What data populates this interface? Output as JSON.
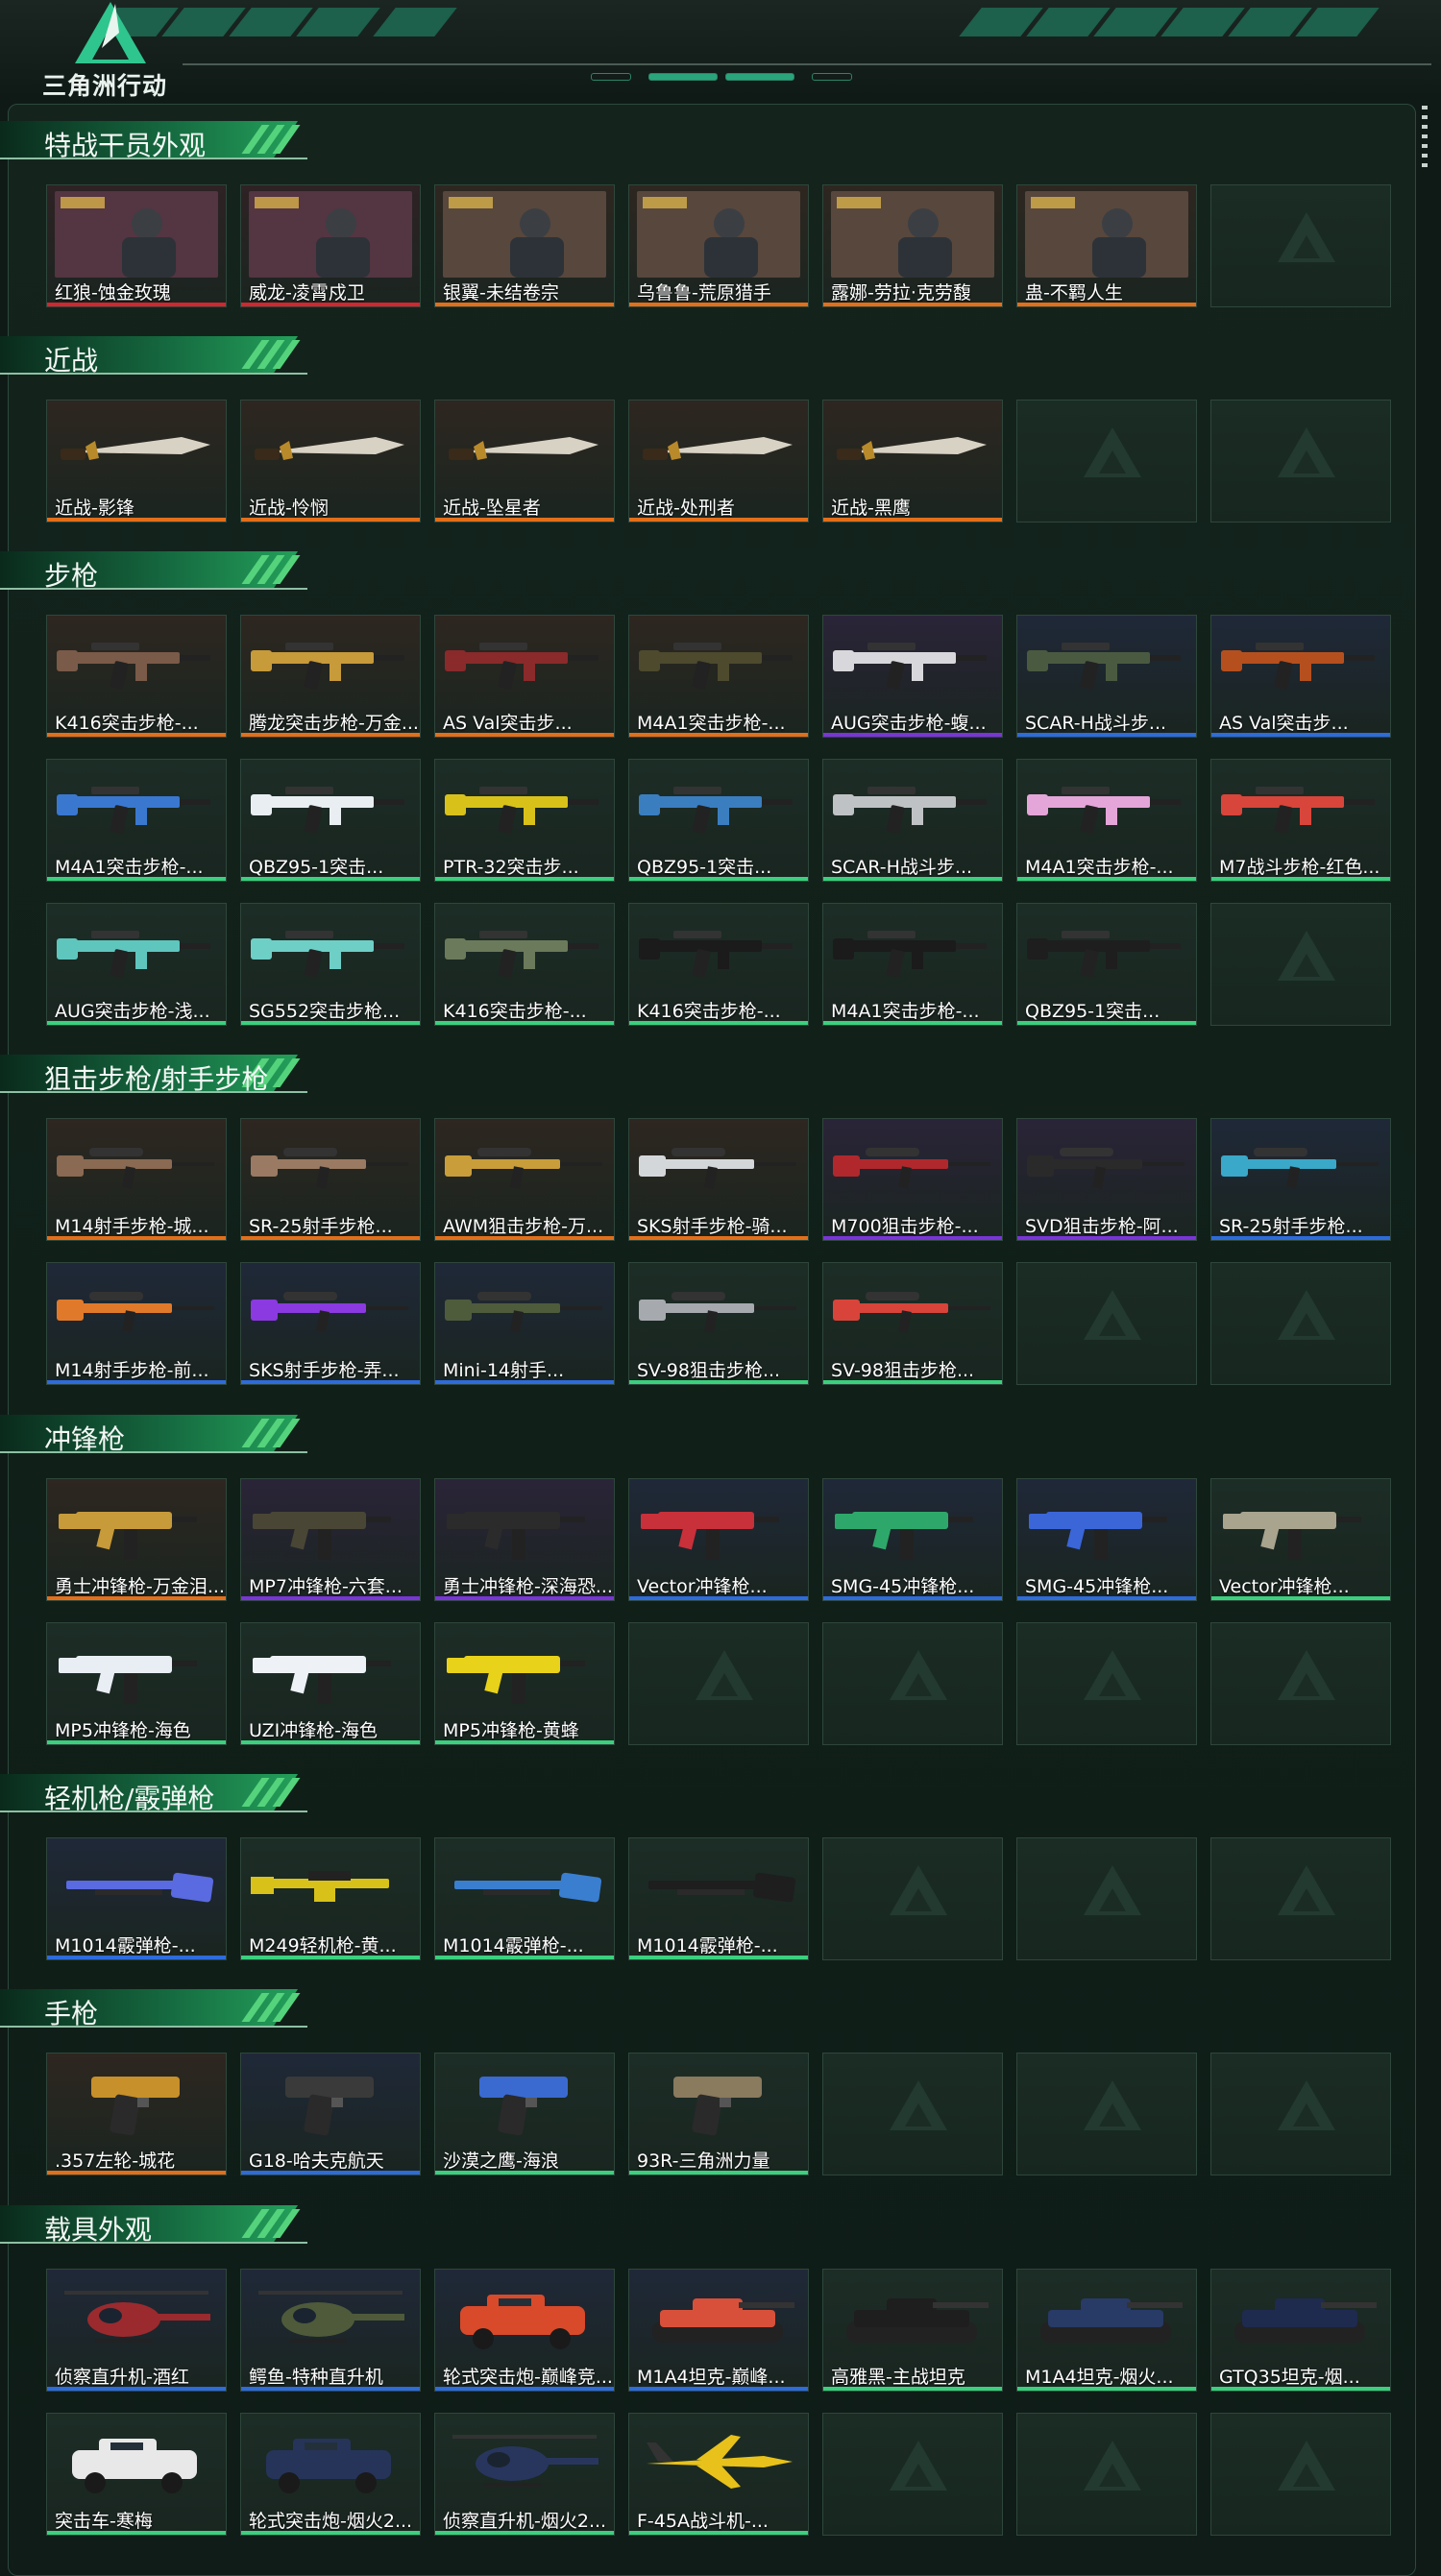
{
  "app": {
    "logo_text": "三角洲行动"
  },
  "colors": {
    "orange": "#e36f1a",
    "red": "#d3262e",
    "purple": "#7a35d8",
    "blue": "#2e6bdb",
    "green": "#3bd07e",
    "gray": "#c9ccca"
  },
  "sections": [
    {
      "title": "特战干员外观",
      "rows": [
        [
          {
            "label": "红狼-蚀金玫瑰",
            "rarity": "red",
            "icon": "operator-portrait"
          },
          {
            "label": "威龙-凌霄戍卫",
            "rarity": "red",
            "icon": "operator-portrait"
          },
          {
            "label": "银翼-未结卷宗",
            "rarity": "orange",
            "icon": "operator-portrait"
          },
          {
            "label": "乌鲁鲁-荒原猎手",
            "rarity": "orange",
            "icon": "operator-portrait"
          },
          {
            "label": "露娜-劳拉·克劳馥",
            "rarity": "orange",
            "icon": "operator-portrait"
          },
          {
            "label": "蛊-不羁人生",
            "rarity": "orange",
            "icon": "operator-portrait"
          },
          null
        ]
      ]
    },
    {
      "title": "近战",
      "rows": [
        [
          {
            "label": "近战-影锋",
            "rarity": "orange",
            "icon": "melee-blade"
          },
          {
            "label": "近战-怜悯",
            "rarity": "orange",
            "icon": "melee-blade"
          },
          {
            "label": "近战-坠星者",
            "rarity": "orange",
            "icon": "melee-blade"
          },
          {
            "label": "近战-处刑者",
            "rarity": "orange",
            "icon": "melee-blade"
          },
          {
            "label": "近战-黑鹰",
            "rarity": "orange",
            "icon": "melee-blade"
          },
          null,
          null
        ]
      ]
    },
    {
      "title": "步枪",
      "rows": [
        [
          {
            "label": "K416突击步枪-...",
            "rarity": "orange",
            "icon": "rifle",
            "tint": "#7a5a48"
          },
          {
            "label": "腾龙突击步枪-万金...",
            "rarity": "orange",
            "icon": "rifle",
            "tint": "#c79a3a"
          },
          {
            "label": "AS Val突击步...",
            "rarity": "orange",
            "icon": "rifle",
            "tint": "#8a2a2a"
          },
          {
            "label": "M4A1突击步枪-...",
            "rarity": "orange",
            "icon": "rifle",
            "tint": "#4d4a2e"
          },
          {
            "label": "AUG突击步枪-蝮...",
            "rarity": "purple",
            "icon": "rifle",
            "tint": "#d8d8dc"
          },
          {
            "label": "SCAR-H战斗步...",
            "rarity": "blue",
            "icon": "rifle",
            "tint": "#4a5a40"
          },
          {
            "label": "AS Val突击步...",
            "rarity": "blue",
            "icon": "rifle",
            "tint": "#b5501e"
          }
        ],
        [
          {
            "label": "M4A1突击步枪-...",
            "rarity": "green",
            "icon": "rifle",
            "tint": "#3a78d0"
          },
          {
            "label": "QBZ95-1突击...",
            "rarity": "green",
            "icon": "rifle",
            "tint": "#e8eef2"
          },
          {
            "label": "PTR-32突击步...",
            "rarity": "green",
            "icon": "rifle",
            "tint": "#d8c21a"
          },
          {
            "label": "QBZ95-1突击...",
            "rarity": "green",
            "icon": "rifle",
            "tint": "#3a7ec0"
          },
          {
            "label": "SCAR-H战斗步...",
            "rarity": "green",
            "icon": "rifle",
            "tint": "#bfc2c4"
          },
          {
            "label": "M4A1突击步枪-...",
            "rarity": "green",
            "icon": "rifle",
            "tint": "#e4a6d8"
          },
          {
            "label": "M7战斗步枪-红色...",
            "rarity": "green",
            "icon": "rifle",
            "tint": "#d8453a"
          }
        ],
        [
          {
            "label": "AUG突击步枪-浅...",
            "rarity": "green",
            "icon": "rifle",
            "tint": "#5fc6be"
          },
          {
            "label": "SG552突击步枪...",
            "rarity": "green",
            "icon": "rifle",
            "tint": "#6ecfc6"
          },
          {
            "label": "K416突击步枪-...",
            "rarity": "green",
            "icon": "rifle",
            "tint": "#6b7a5a"
          },
          {
            "label": "K416突击步枪-...",
            "rarity": "green",
            "icon": "rifle",
            "tint": "#1b1b1b"
          },
          {
            "label": "M4A1突击步枪-...",
            "rarity": "green",
            "icon": "rifle",
            "tint": "#1b1b1b"
          },
          {
            "label": "QBZ95-1突击...",
            "rarity": "green",
            "icon": "rifle",
            "tint": "#1e1e1e"
          },
          null
        ]
      ]
    },
    {
      "title": "狙击步枪/射手步枪",
      "rows": [
        [
          {
            "label": "M14射手步枪-城...",
            "rarity": "orange",
            "icon": "sniper",
            "tint": "#8a6a52"
          },
          {
            "label": "SR-25射手步枪...",
            "rarity": "orange",
            "icon": "sniper",
            "tint": "#9a7a62"
          },
          {
            "label": "AWM狙击步枪-万...",
            "rarity": "orange",
            "icon": "sniper",
            "tint": "#c99e3a"
          },
          {
            "label": "SKS射手步枪-骑...",
            "rarity": "orange",
            "icon": "sniper",
            "tint": "#d4d7da"
          },
          {
            "label": "M700狙击步枪-...",
            "rarity": "purple",
            "icon": "sniper",
            "tint": "#b0282c"
          },
          {
            "label": "SVD狙击步枪-阿...",
            "rarity": "purple",
            "icon": "sniper",
            "tint": "#2a2a2a"
          },
          {
            "label": "SR-25射手步枪...",
            "rarity": "blue",
            "icon": "sniper",
            "tint": "#3aa8c8"
          }
        ],
        [
          {
            "label": "M14射手步枪-前...",
            "rarity": "blue",
            "icon": "sniper",
            "tint": "#e07a2a"
          },
          {
            "label": "SKS射手步枪-弄...",
            "rarity": "blue",
            "icon": "sniper",
            "tint": "#8a3ae0"
          },
          {
            "label": "Mini-14射手...",
            "rarity": "blue",
            "icon": "sniper",
            "tint": "#4e5c3c"
          },
          {
            "label": "SV-98狙击步枪...",
            "rarity": "green",
            "icon": "sniper",
            "tint": "#a6aaae"
          },
          {
            "label": "SV-98狙击步枪...",
            "rarity": "green",
            "icon": "sniper",
            "tint": "#d8443a"
          },
          null,
          null
        ]
      ]
    },
    {
      "title": "冲锋枪",
      "rows": [
        [
          {
            "label": "勇士冲锋枪-万金泪...",
            "rarity": "orange",
            "icon": "smg",
            "tint": "#c79a3a"
          },
          {
            "label": "MP7冲锋枪-六套...",
            "rarity": "purple",
            "icon": "smg",
            "tint": "#4a4636"
          },
          {
            "label": "勇士冲锋枪-深海恐...",
            "rarity": "purple",
            "icon": "smg",
            "tint": "#2b2b2b"
          },
          {
            "label": "Vector冲锋枪...",
            "rarity": "blue",
            "icon": "smg",
            "tint": "#c8303a"
          },
          {
            "label": "SMG-45冲锋枪...",
            "rarity": "blue",
            "icon": "smg",
            "tint": "#2ea86a"
          },
          {
            "label": "SMG-45冲锋枪...",
            "rarity": "blue",
            "icon": "smg",
            "tint": "#3a66d8"
          },
          {
            "label": "Vector冲锋枪...",
            "rarity": "green",
            "icon": "smg",
            "tint": "#a8a48e"
          }
        ],
        [
          {
            "label": "MP5冲锋枪-海色",
            "rarity": "green",
            "icon": "smg",
            "tint": "#e8eef4"
          },
          {
            "label": "UZI冲锋枪-海色",
            "rarity": "green",
            "icon": "smg",
            "tint": "#eef2f6"
          },
          {
            "label": "MP5冲锋枪-黄蜂",
            "rarity": "green",
            "icon": "smg",
            "tint": "#e8d21a"
          },
          null,
          null,
          null,
          null
        ]
      ]
    },
    {
      "title": "轻机枪/霰弹枪",
      "rows": [
        [
          {
            "label": "M1014霰弹枪-...",
            "rarity": "blue",
            "icon": "shotgun",
            "tint": "#5a6ae0"
          },
          {
            "label": "M249轻机枪-黄...",
            "rarity": "green",
            "icon": "lmg",
            "tint": "#d8c21a"
          },
          {
            "label": "M1014霰弹枪-...",
            "rarity": "green",
            "icon": "shotgun",
            "tint": "#3a7ed0"
          },
          {
            "label": "M1014霰弹枪-...",
            "rarity": "green",
            "icon": "shotgun",
            "tint": "#1e1e1e"
          },
          null,
          null,
          null
        ]
      ]
    },
    {
      "title": "手枪",
      "rows": [
        [
          {
            "label": ".357左轮-城花",
            "rarity": "orange",
            "icon": "pistol",
            "tint": "#c7902a"
          },
          {
            "label": "G18-哈夫克航天",
            "rarity": "blue",
            "icon": "pistol",
            "tint": "#3a3a3a"
          },
          {
            "label": "沙漠之鹰-海浪",
            "rarity": "green",
            "icon": "pistol",
            "tint": "#3a6ad0"
          },
          {
            "label": "93R-三角洲力量",
            "rarity": "green",
            "icon": "pistol",
            "tint": "#8a7a5e"
          },
          null,
          null,
          null
        ]
      ]
    },
    {
      "title": "载具外观",
      "rows": [
        [
          {
            "label": "侦察直升机-酒红",
            "rarity": "blue",
            "icon": "helicopter",
            "tint": "#9a2a2e"
          },
          {
            "label": "鳄鱼-特种直升机",
            "rarity": "blue",
            "icon": "helicopter",
            "tint": "#4e5a3a"
          },
          {
            "label": "轮式突击炮-巅峰竞...",
            "rarity": "blue",
            "icon": "armored-car",
            "tint": "#d84a2a"
          },
          {
            "label": "M1A4坦克-巅峰...",
            "rarity": "blue",
            "icon": "tank",
            "tint": "#d8503a"
          },
          {
            "label": "高雅黑-主战坦克",
            "rarity": "green",
            "icon": "tank",
            "tint": "#1e1e1e"
          },
          {
            "label": "M1A4坦克-烟火...",
            "rarity": "green",
            "icon": "tank",
            "tint": "#283a66"
          },
          {
            "label": "GTQ35坦克-烟...",
            "rarity": "green",
            "icon": "tank",
            "tint": "#1e2a4e"
          }
        ],
        [
          {
            "label": "突击车-寒梅",
            "rarity": "green",
            "icon": "armored-car",
            "tint": "#e8e8e8"
          },
          {
            "label": "轮式突击炮-烟火2...",
            "rarity": "green",
            "icon": "armored-car",
            "tint": "#26345a"
          },
          {
            "label": "侦察直升机-烟火2...",
            "rarity": "green",
            "icon": "helicopter",
            "tint": "#28365e"
          },
          {
            "label": "F-45A战斗机-...",
            "rarity": "green",
            "icon": "jet",
            "tint": "#e8c21a"
          },
          null,
          null,
          null
        ]
      ]
    }
  ]
}
